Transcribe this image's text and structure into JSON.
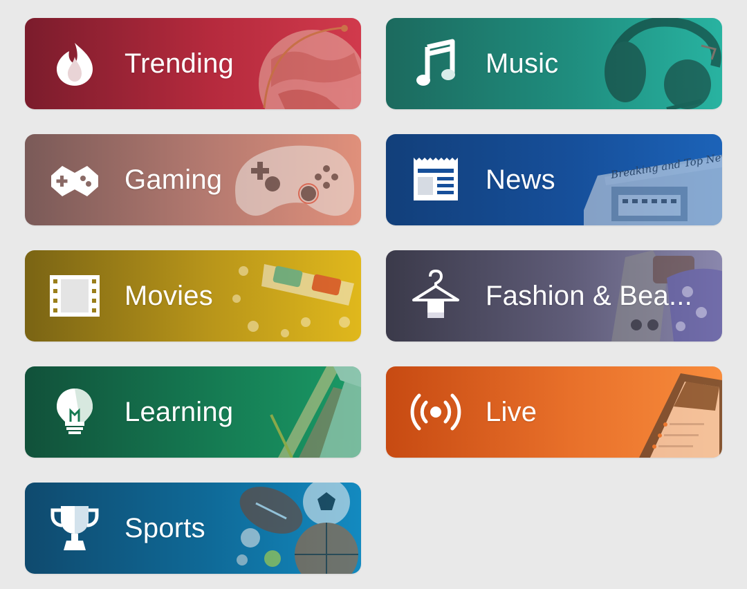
{
  "categories": [
    {
      "label": "Trending",
      "icon": "flame-icon",
      "art": "globe-image"
    },
    {
      "label": "Music",
      "icon": "music-note-icon",
      "art": "headphones-image"
    },
    {
      "label": "Gaming",
      "icon": "game-controller-icon",
      "art": "gamepad-image"
    },
    {
      "label": "News",
      "icon": "newspaper-icon",
      "art": "newspaper-image",
      "art_text": "Breaking and Top News"
    },
    {
      "label": "Movies",
      "icon": "film-strip-icon",
      "art": "3d-glasses-popcorn-image"
    },
    {
      "label": "Fashion & Bea...",
      "icon": "hanger-icon",
      "art": "clothes-accessories-image"
    },
    {
      "label": "Learning",
      "icon": "lightbulb-icon",
      "art": "notebook-pencil-image"
    },
    {
      "label": "Live",
      "icon": "broadcast-icon",
      "art": "phone-livestream-image"
    },
    {
      "label": "Sports",
      "icon": "trophy-icon",
      "art": "balls-image"
    }
  ],
  "colors": {
    "page_background": "#e9e9e9",
    "trending": "#b52a3d",
    "music": "#1f8d7e",
    "gaming": "#b57a70",
    "news": "#164f9a",
    "movies": "#b8951a",
    "fashion": "#5f5c78",
    "learning": "#157a52",
    "live": "#e8702a",
    "sports": "#0f6a98"
  }
}
